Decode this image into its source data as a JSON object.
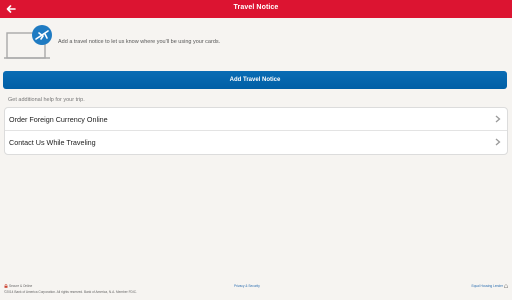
{
  "header": {
    "title": "Travel Notice",
    "back_icon": "back-arrow-icon",
    "color": "#dc1431"
  },
  "intro": {
    "icon": "laptop-airplane-icon",
    "text": "Add a travel notice to let us know where you'll be using your cards."
  },
  "primary_button": {
    "label": "Add Travel Notice",
    "color": "#0a6cb4"
  },
  "help": {
    "heading": "Get additional help for your trip.",
    "links": [
      {
        "label": "Order Foreign Currency Online"
      },
      {
        "label": "Contact Us While Traveling"
      }
    ]
  },
  "footer": {
    "secure_label": "Secure & Online",
    "privacy_link": "Privacy & Security",
    "equal_housing": "Equal Housing Lender",
    "copyright": "©2014 Bank of America Corporation. All rights reserved. Bank of America, N.A. Member FDIC."
  }
}
